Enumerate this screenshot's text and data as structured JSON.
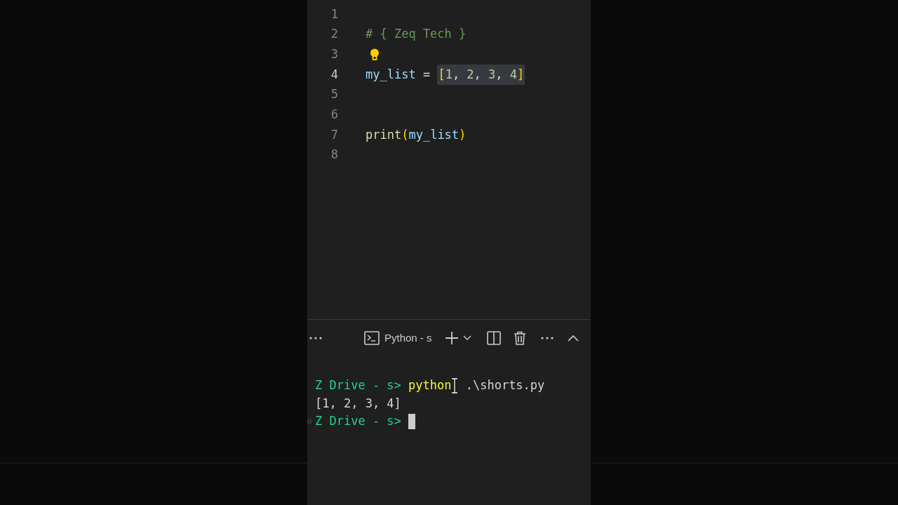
{
  "editor": {
    "lines": [
      {
        "number": "1",
        "active": false
      },
      {
        "number": "2",
        "active": false,
        "tokens": [
          {
            "kind": "comment",
            "text": "# { Zeq Tech }"
          }
        ]
      },
      {
        "number": "3",
        "active": false,
        "lightbulb": true
      },
      {
        "number": "4",
        "active": true,
        "tokens": [
          {
            "kind": "variable",
            "text": "my_list"
          },
          {
            "kind": "plain",
            "text": " = "
          },
          {
            "kind": "highlight",
            "tokens": [
              {
                "kind": "bracket",
                "text": "["
              },
              {
                "kind": "number",
                "text": "1"
              },
              {
                "kind": "plain",
                "text": ", "
              },
              {
                "kind": "number",
                "text": "2"
              },
              {
                "kind": "plain",
                "text": ", "
              },
              {
                "kind": "number",
                "text": "3"
              },
              {
                "kind": "plain",
                "text": ", "
              },
              {
                "kind": "number",
                "text": "4"
              },
              {
                "kind": "bracket",
                "text": "]"
              }
            ]
          }
        ]
      },
      {
        "number": "5",
        "active": false
      },
      {
        "number": "6",
        "active": false
      },
      {
        "number": "7",
        "active": false,
        "tokens": [
          {
            "kind": "function",
            "text": "print"
          },
          {
            "kind": "bracket",
            "text": "("
          },
          {
            "kind": "variable",
            "text": "my_list"
          },
          {
            "kind": "bracket",
            "text": ")"
          }
        ]
      },
      {
        "number": "8",
        "active": false
      }
    ]
  },
  "terminal": {
    "tab_label": "Python - s",
    "lines": [
      [
        {
          "kind": "prompt",
          "text": "Z Drive - s> "
        },
        {
          "kind": "command",
          "text": "python"
        },
        {
          "kind": "mouse"
        },
        {
          "kind": "plain",
          "text": " .\\shorts.py"
        }
      ],
      [
        {
          "kind": "plain",
          "text": "[1, 2, 3, 4]"
        }
      ],
      [
        {
          "kind": "prompt",
          "text": "Z Drive - s> "
        },
        {
          "kind": "cursor"
        }
      ]
    ]
  }
}
